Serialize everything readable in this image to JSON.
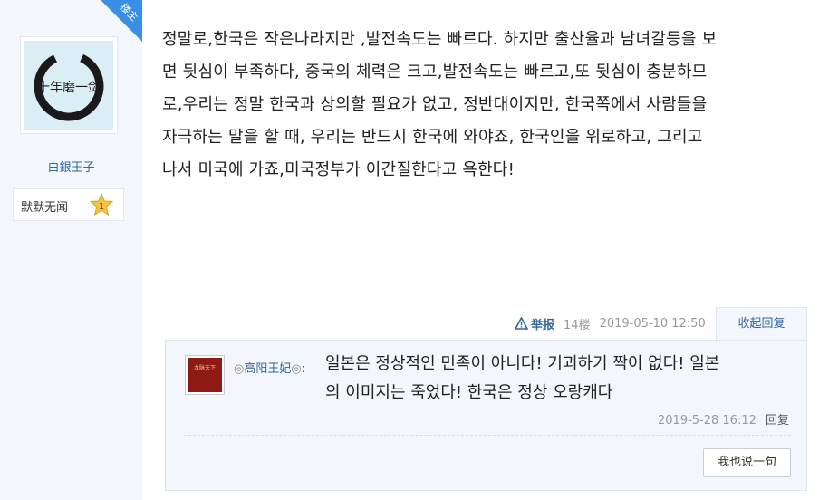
{
  "author": {
    "username": "白銀王子",
    "avatar": "calligraphy-avatar",
    "avatar_text": "十年磨一剑",
    "medal_label": "默默无闻",
    "medal_level": "1",
    "badge": "楼主"
  },
  "post": {
    "lines": [
      "정말로,한국은 작은나라지만 ,발전속도는 빠르다. 하지만 출산율과 남녀갈등을 보",
      "면 뒷심이 부족하다, 중국의 체력은 크고,발전속도는 빠르고,또 뒷심이 충분하므",
      "로,우리는 정말 한국과 상의할 필요가 없고, 정반대이지만, 한국쪽에서 사람들을",
      "자극하는 말을 할 때, 우리는 반드시 한국에 와야죠, 한국인을 위로하고, 그리고",
      "나서 미국에 가죠,미국정부가 이간질한다고 욕한다!"
    ],
    "report_label": "举报",
    "floor": "14楼",
    "time": "2019-05-10 12:50",
    "collapse_label": "收起回复"
  },
  "reply": {
    "username": "高阳王妃",
    "ornament": "◎",
    "avatar_text": "龙脉天下",
    "lines": [
      "일본은 정상적인 민족이 아니다! 기괴하기 짝이 없다! 일본",
      "의 이미지는 죽었다! 한국은 정상 오랑캐다"
    ],
    "time": "2019-5-28 16:12",
    "reply_label": "回复"
  },
  "say_button": "我也说一句",
  "colors": {
    "link": "#336699",
    "badge": "#3a8ee6",
    "sidebar_bg": "#f3f6fb",
    "medal": "#f6c343"
  }
}
